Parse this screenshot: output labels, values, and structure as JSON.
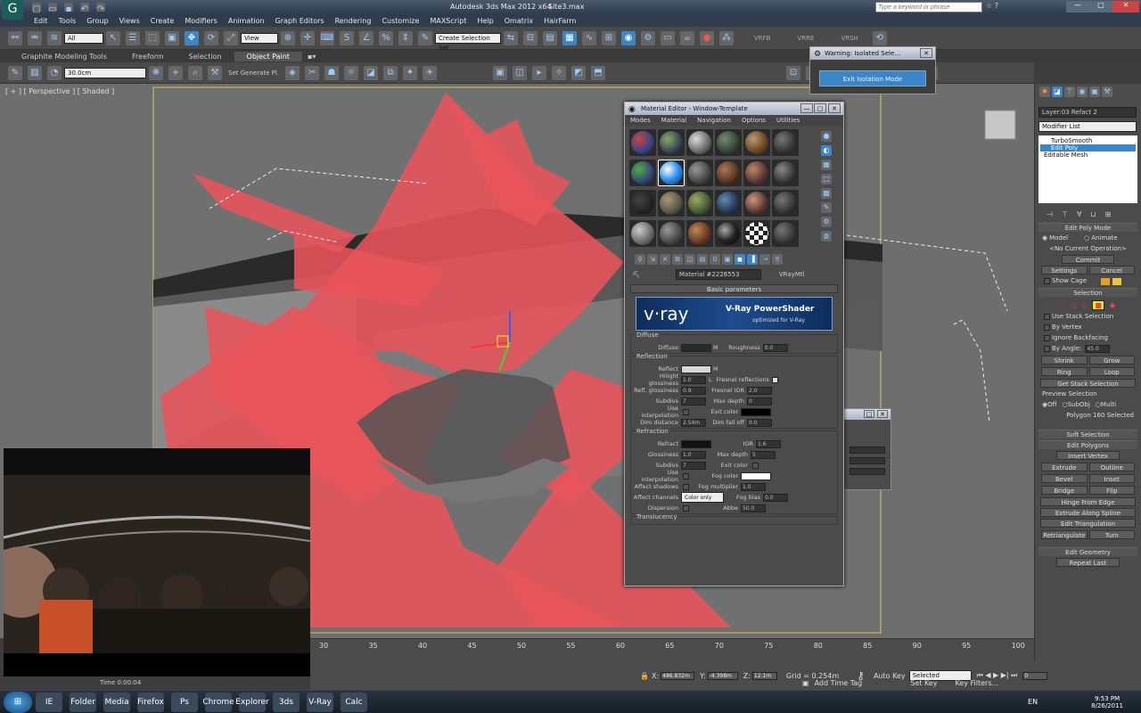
{
  "title": {
    "app_title": "Autodesk 3ds Max 2012 x64",
    "file": "Site3.max",
    "search_placeholder": "Type a keyword or phrase"
  },
  "menus": [
    "Edit",
    "Tools",
    "Group",
    "Views",
    "Create",
    "Modifiers",
    "Animation",
    "Graph Editors",
    "Rendering",
    "Customize",
    "MAXScript",
    "Help",
    "Omatrix",
    "HairFarm"
  ],
  "toolbar": {
    "selection_filter": "All",
    "ref_coord": "View",
    "named_sel": "Create Selection Set",
    "vray_labels": [
      "VRFB",
      "VRRE",
      "VRSH"
    ]
  },
  "ribbon": {
    "tabs": [
      "Graphite Modeling Tools",
      "Freeform",
      "Selection",
      "Object Paint"
    ],
    "size_field": "30.0cm",
    "paint_label": "Set Generate Pl."
  },
  "viewport": {
    "label": "[ + ] [ Perspective ] [ Shaded ]"
  },
  "warning": {
    "title": "Warning: Isolated Sele...",
    "button": "Exit Isolation Mode"
  },
  "material_editor": {
    "title": "Material Editor - Window-Template",
    "menu": [
      "Modes",
      "Material",
      "Navigation",
      "Options",
      "Utilities"
    ],
    "material_name": "Material #2226553",
    "material_type": "VRayMtl",
    "rollout": "Basic parameters",
    "banner": {
      "brand": "v·ray",
      "title": "V-Ray PowerShader",
      "subtitle": "optimized for V-Ray"
    },
    "diffuse": {
      "group": "Diffuse",
      "diffuse_label": "Diffuse",
      "roughness_label": "Roughness",
      "roughness": "0.0"
    },
    "reflection": {
      "group": "Reflection",
      "reflect": "Reflect",
      "hilight": "Hilight glossiness",
      "hilight_val": "1.0",
      "refl_gloss": "Refl. glossiness",
      "refl_gloss_val": "0.9",
      "subdivs": "Subdivs",
      "subdivs_val": "7",
      "use_interp": "Use interpolation",
      "dim_dist": "Dim distance",
      "dim_dist_val": "2.54m",
      "fresnel": "Fresnel reflections",
      "fresnel_ior": "Fresnel IOR",
      "fresnel_ior_val": "2.0",
      "max_depth": "Max depth",
      "max_depth_val": "0",
      "exit_color": "Exit color",
      "dim_falloff": "Dim fall off",
      "dim_falloff_val": "0.0"
    },
    "refraction": {
      "group": "Refraction",
      "refract": "Refract",
      "ior": "IOR",
      "ior_val": "1.6",
      "glossiness": "Glossiness",
      "glossiness_val": "1.0",
      "max_depth": "Max depth",
      "max_depth_val": "5",
      "subdivs": "Subdivs",
      "subdivs_val": "7",
      "exit_color": "Exit color",
      "use_interp": "Use interpolation",
      "fog_color": "Fog color",
      "affect_shadows": "Affect shadows",
      "fog_mult": "Fog multiplier",
      "fog_mult_val": "1.0",
      "affect_channels": "Affect channels",
      "channels_val": "Color only",
      "fog_bias": "Fog bias",
      "fog_bias_val": "0.0",
      "dispersion": "Dispersion",
      "abbe": "Abbe",
      "abbe_val": "50.0"
    },
    "translucency": "Translucency"
  },
  "command_panel": {
    "object_name": "Layer:03 Refact 2",
    "modifier_list": "Modifier List",
    "stack": [
      "TurboSmooth",
      "Edit Poly",
      "Editable Mesh"
    ],
    "edit_poly_mode": "Edit Poly Mode",
    "model": "Model",
    "animate": "Animate",
    "no_op": "<No Current Operation>",
    "commit": "Commit",
    "settings": "Settings",
    "cancel": "Cancel",
    "show_cage": "Show Cage",
    "selection": "Selection",
    "use_stack": "Use Stack Selection",
    "by_vertex": "By Vertex",
    "ignore_backfacing": "Ignore Backfacing",
    "by_angle": "By Angle:",
    "by_angle_val": "45.0",
    "shrink": "Shrink",
    "grow": "Grow",
    "ring": "Ring",
    "loop": "Loop",
    "get_stack": "Get Stack Selection",
    "preview": "Preview Selection",
    "off": "Off",
    "subobj": "SubObj",
    "multi": "Multi",
    "polygons_sel": "Polygon 160 Selected",
    "soft_sel": "Soft Selection",
    "edit_polys": "Edit Polygons",
    "insert_vertex": "Insert Vertex",
    "extrude": "Extrude",
    "outline": "Outline",
    "bevel": "Bevel",
    "inset": "Inset",
    "bridge": "Bridge",
    "flip": "Flip",
    "hinge": "Hinge From Edge",
    "extrude_spline": "Extrude Along Spline",
    "edit_tri": "Edit Triangulation",
    "retriangulate": "Retriangulate",
    "turn": "Turn",
    "edit_geom": "Edit Geometry",
    "repeat_last": "Repeat Last"
  },
  "timeline": {
    "ticks": [
      "30",
      "35",
      "40",
      "45",
      "50",
      "55",
      "60",
      "65",
      "70",
      "75",
      "80",
      "85",
      "90",
      "95",
      "100"
    ]
  },
  "status": {
    "x": "486.832m",
    "y": "-4.398m",
    "z": "12.1m",
    "grid": "Grid = 0.254m",
    "autokey": "Auto Key",
    "selected": "Selected",
    "setkey": "Set Key",
    "keyfilters": "Key Filters...",
    "addtime": "Add Time Tag",
    "frame": "0",
    "time": "Time 0:00:04"
  },
  "taskbar": {
    "apps": [
      "IE",
      "Folder",
      "Media",
      "Firefox",
      "Ps",
      "Chrome",
      "Explorer",
      "3ds",
      "V-Ray",
      "Calc"
    ],
    "lang": "EN",
    "clock": "9:53 PM",
    "date": "8/26/2011"
  },
  "colors": {
    "red_geo": "#e8545a",
    "accent": "#3a86c8"
  }
}
